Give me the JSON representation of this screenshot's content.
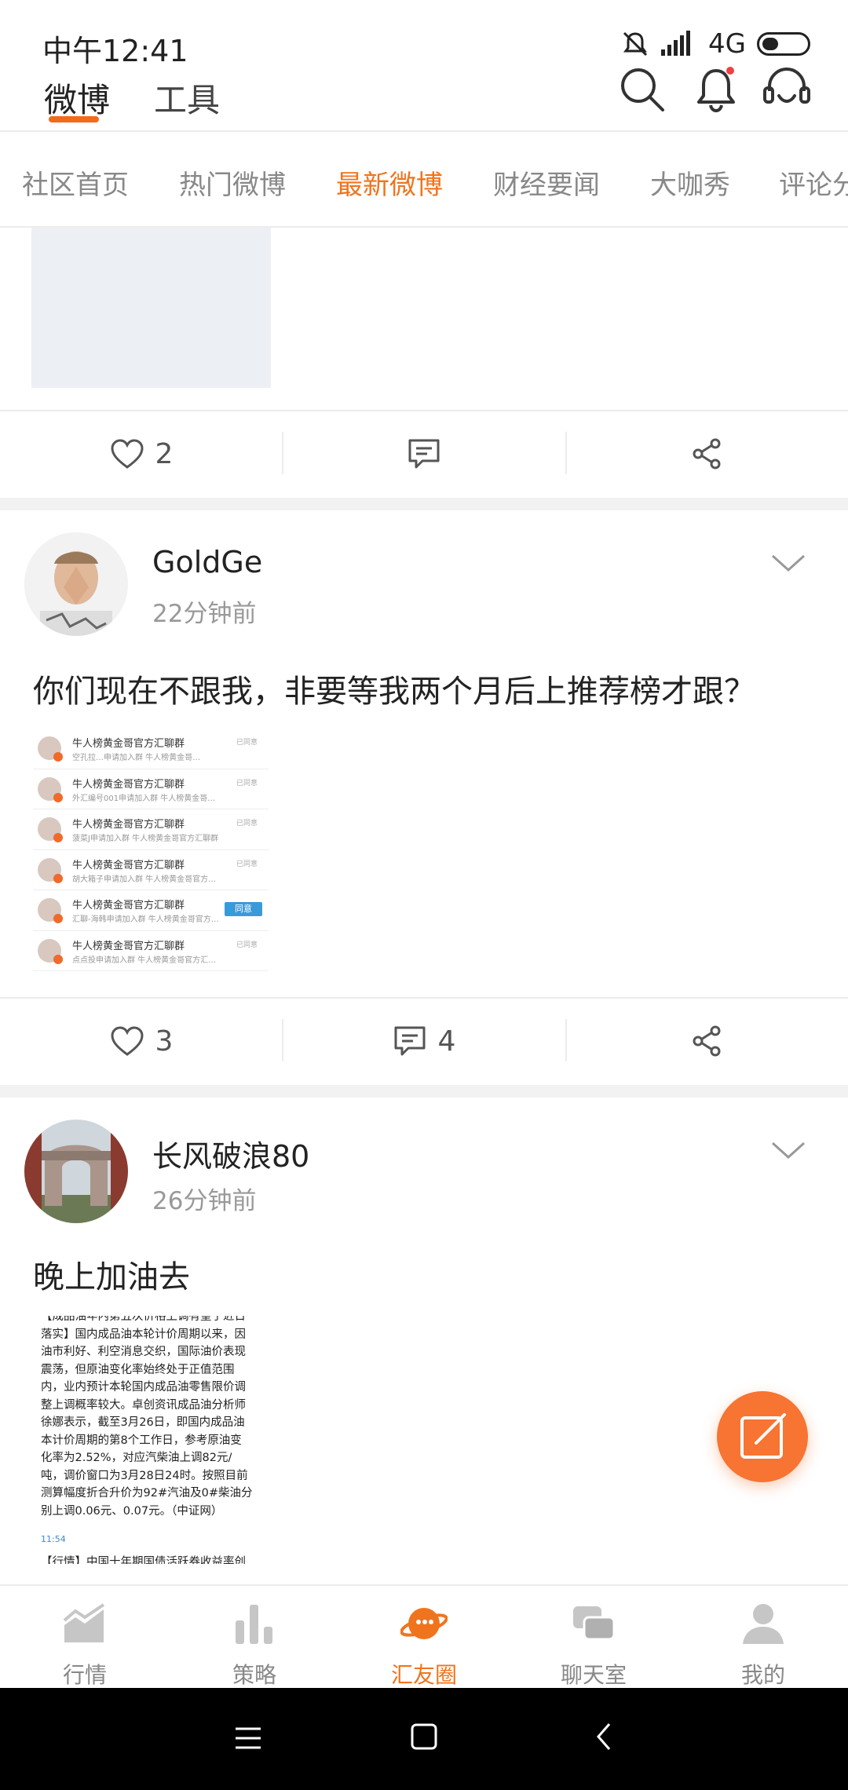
{
  "status_bar": {
    "time": "中午12:41",
    "network": "4G"
  },
  "header": {
    "tabs": [
      "微博",
      "工具"
    ],
    "active_tab": "微博",
    "accent": "#f26b1d"
  },
  "channels": {
    "items": [
      "社区首页",
      "热门微博",
      "最新微博",
      "财经要闻",
      "大咖秀",
      "评论分"
    ],
    "active": "最新微博",
    "active_color": "#f0741d"
  },
  "prev_post": {
    "likes": "2"
  },
  "posts": [
    {
      "author": "GoldGe",
      "time": "22分钟前",
      "text": "你们现在不跟我，非要等我两个月后上推荐榜才跟？",
      "likes": "3",
      "comments": "4",
      "chat_rows": [
        {
          "title": "牛人榜黄金哥官方汇聊群",
          "sub": "空孔拉…申请加入群 牛人榜黄金哥…",
          "status": "已同意"
        },
        {
          "title": "牛人榜黄金哥官方汇聊群",
          "sub": "外汇编号001申请加入群 牛人榜黄金哥…",
          "status": "已同意"
        },
        {
          "title": "牛人榜黄金哥官方汇聊群",
          "sub": "菠菜J申请加入群 牛人榜黄金哥官方汇聊群",
          "status": "已同意"
        },
        {
          "title": "牛人榜黄金哥官方汇聊群",
          "sub": "胡大箱子申请加入群 牛人榜黄金哥官方…",
          "status": "已同意"
        },
        {
          "title": "牛人榜黄金哥官方汇聊群",
          "sub": "汇聊-海韩申请加入群 牛人榜黄金哥官方…",
          "button": "同意"
        },
        {
          "title": "牛人榜黄金哥官方汇聊群",
          "sub": "点点投申请加入群 牛人榜黄金哥官方汇…",
          "status": "已同意"
        }
      ]
    },
    {
      "author": "长风破浪80",
      "time": "26分钟前",
      "text": "晚上加油去",
      "news_lines": [
        "【成品油年内第五次价格上调有望于近日",
        "落实】国内成品油本轮计价周期以来，因",
        "油市利好、利空消息交织，国际油价表现",
        "震荡，但原油变化率始终处于正值范围",
        "内，业内预计本轮国内成品油零售限价调",
        "整上调概率较大。卓创资讯成品油分析师",
        "徐娜表示，截至3月26日，即国内成品油",
        "本计价周期的第8个工作日，参考原油变",
        "化率为2.52%，对应汽柴油上调82元/",
        "吨，调价窗口为3月28日24时。按照目前",
        "测算幅度折合升价为92#汽油及0#柴油分",
        "别上调0.06元、0.07元。（中证网）"
      ],
      "news_clock": "11:54",
      "news_next": "【行情】中国十年期国债活跃券收益率创"
    }
  ],
  "bottom_nav": {
    "items": [
      {
        "label": "行情",
        "icon": "chart-icon"
      },
      {
        "label": "策略",
        "icon": "bar-chart-icon"
      },
      {
        "label": "汇友圈",
        "icon": "planet-icon"
      },
      {
        "label": "聊天室",
        "icon": "chat-icon"
      },
      {
        "label": "我的",
        "icon": "person-icon"
      }
    ],
    "active": "汇友圈"
  }
}
